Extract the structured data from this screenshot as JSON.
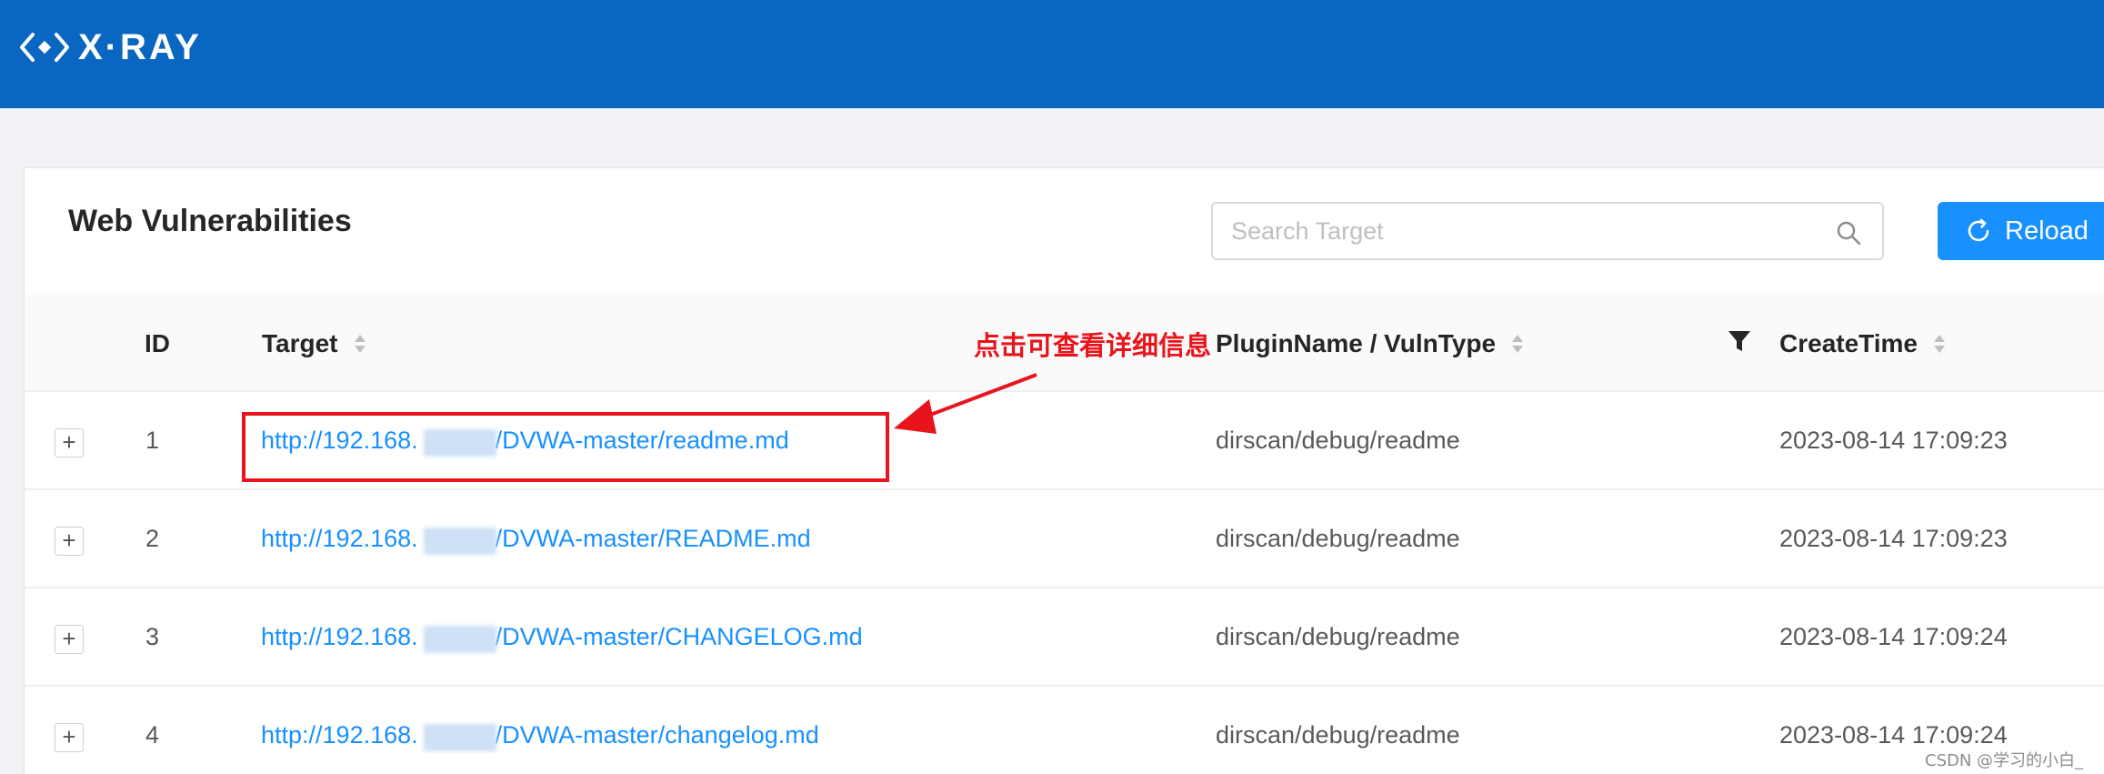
{
  "brand": {
    "name": "X·RAY",
    "icon": "diamond-code-logo"
  },
  "page": {
    "title": "Web Vulnerabilities"
  },
  "search": {
    "placeholder": "Search Target",
    "value": "",
    "icon": "search-icon"
  },
  "toolbar": {
    "reload_label": "Reload",
    "reload_icon": "reload-icon"
  },
  "table": {
    "columns": {
      "id": "ID",
      "target": "Target",
      "plugin": "PluginName / VulnType",
      "create_time": "CreateTime"
    },
    "rows": [
      {
        "id": "1",
        "target_prefix": "http://192.168.",
        "target_suffix": "/DVWA-master/readme.md",
        "plugin": "dirscan/debug/readme",
        "create_time": "2023-08-14 17:09:23"
      },
      {
        "id": "2",
        "target_prefix": "http://192.168.",
        "target_suffix": "/DVWA-master/README.md",
        "plugin": "dirscan/debug/readme",
        "create_time": "2023-08-14 17:09:23"
      },
      {
        "id": "3",
        "target_prefix": "http://192.168.",
        "target_suffix": "/DVWA-master/CHANGELOG.md",
        "plugin": "dirscan/debug/readme",
        "create_time": "2023-08-14 17:09:24"
      },
      {
        "id": "4",
        "target_prefix": "http://192.168.",
        "target_suffix": "/DVWA-master/changelog.md",
        "plugin": "dirscan/debug/readme",
        "create_time": "2023-08-14 17:09:24"
      }
    ]
  },
  "annotation": {
    "text": "点击可查看详细信息",
    "color": "#e8141c"
  },
  "watermark": "CSDN @学习的小白_",
  "colors": {
    "header": "#0a67c1",
    "primary": "#1890ff",
    "link": "#1890ff"
  }
}
